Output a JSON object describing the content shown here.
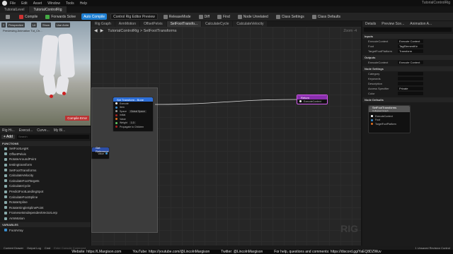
{
  "menubar": {
    "items": [
      "File",
      "Edit",
      "Asset",
      "Window",
      "Tools",
      "Help"
    ],
    "title": "TutorialControlRig"
  },
  "tabs": [
    "TutorialLevel",
    "TutorialControlRig"
  ],
  "toolbar": {
    "compile": "Compile",
    "forwards_solve": "Forwards Solve",
    "auto_compile": "Auto Compile",
    "preview_dropdown": "Control Rig Editor Preview",
    "release_mode": "ReleaseMode",
    "diff": "Diff",
    "find": "Find",
    "node_unrelated": "Node Unrelated",
    "class_settings": "Class Settings",
    "class_defaults": "Class Defaults"
  },
  "viewport": {
    "buttons": [
      "Perspective",
      "Lit",
      "Show",
      "Use Anim"
    ],
    "preview_label": "Previewing Animation Tut_Ch...",
    "compile_error": "Compile Error"
  },
  "left_panel": {
    "tabs": [
      "Rig Hi...",
      "Execut...",
      "Curve...",
      "My Bl..."
    ],
    "add": "+ Add",
    "search_placeholder": "Search",
    "functions_header": "FUNCTIONS",
    "functions": [
      "SetFootLegIK",
      "OffsetPelvis",
      "RotateAroundPoint",
      "testingtransform",
      "SetFootTransforms",
      "CalculateVelocity",
      "CalculateFootTargets",
      "CalculateCycle",
      "PredictFootLandingSpot",
      "CalculateFootSpline",
      "RotateSpline",
      "RotateSingleSplinePoint",
      "FramesetsIndependentVectorLerp",
      "ArmMotion"
    ],
    "variables_header": "VARIABLES",
    "variables": [
      "FootArray"
    ]
  },
  "graph_tabs": [
    "Rig Graph",
    "ArmMotion",
    "OffsetPelvis",
    "SetFootTransfo...",
    "CalculateCycle",
    "CalculateVelocity"
  ],
  "graph": {
    "path": "TutorialControlRig  >  SetFootTransforms",
    "zoom": "Zoom -4",
    "watermark": "RIG",
    "nodes": {
      "set_transform": {
        "title": "Set Transform - Bone",
        "pins": [
          "Execute",
          "Item",
          "Space",
          "Initial",
          "Value",
          "Weight",
          "Propagate to Children"
        ],
        "space_value": "Global Space",
        "weight_value": "1.0"
      },
      "return": {
        "title": "Return",
        "pins": [
          "ExecuteContext"
        ]
      },
      "get_reference": {
        "title": "Get Reference",
        "pins": [
          "Value"
        ]
      }
    }
  },
  "details": {
    "tabs": [
      "Details",
      "Preview Sce...",
      "Animation A..."
    ],
    "inputs_header": "Inputs",
    "inputs": [
      {
        "label": "ExecuteContext",
        "value": "Execute Context"
      },
      {
        "label": "Foot",
        "value": "TagElementKe"
      },
      {
        "label": "TargetFootPlatform",
        "value": "Transform"
      }
    ],
    "outputs_header": "Outputs",
    "outputs": [
      {
        "label": "ExecuteContext",
        "value": "Execute Context"
      }
    ],
    "settings_header": "Node Settings",
    "settings": [
      {
        "label": "Category",
        "value": ""
      },
      {
        "label": "Keywords",
        "value": ""
      },
      {
        "label": "Description",
        "value": ""
      },
      {
        "label": "Access Specifier",
        "value": "Private"
      },
      {
        "label": "Color",
        "value": ""
      }
    ],
    "defaults_header": "Node Defaults",
    "preview_node": {
      "title": "SetFootTransforms",
      "subtitle": "Collapsed Graph",
      "pins": [
        "ExecuteContext",
        "Foot",
        "TargetFootPlatform"
      ]
    }
  },
  "statusbar": {
    "items": [
      "Content Drawer",
      "Output Log",
      "Cmd",
      "Enter Console Command"
    ],
    "right": "1 Unsaved  Revision Control"
  },
  "banner": [
    "Website: https://LMargison.com",
    "YouTube: https://youtube.com/@LincolnMargison",
    "Twitter: @LincolnMargison",
    "For help, questions and comments: https://discord.gg/YaEQ8DZWuv"
  ],
  "colors": {
    "accent": "#1f7fd1",
    "exec": "#ffffff",
    "struct": "#2d6fd8",
    "return_header": "#8a2fae"
  }
}
